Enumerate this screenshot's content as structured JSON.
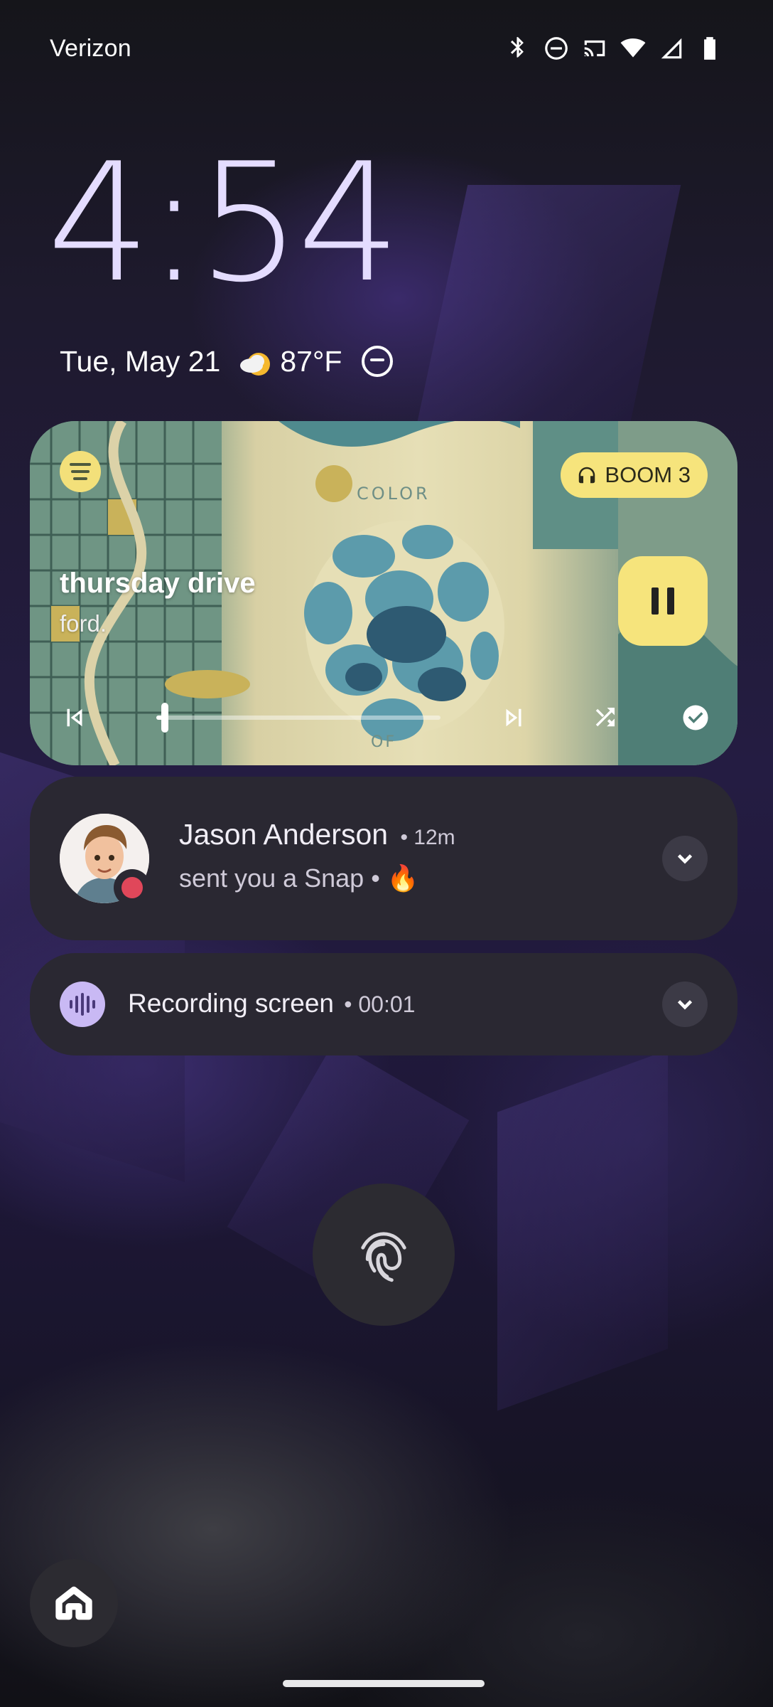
{
  "status_bar": {
    "carrier": "Verizon",
    "icons": [
      "bluetooth-icon",
      "do-not-disturb-icon",
      "cast-icon",
      "wifi-icon",
      "cell-signal-icon",
      "battery-icon"
    ]
  },
  "lockscreen": {
    "time": "4:54",
    "date": "Tue, May 21",
    "temperature": "87°F",
    "weather_icon": "partly-sunny-icon"
  },
  "media_player": {
    "app_icon": "spotify-icon",
    "output_device": "BOOM 3",
    "title": "thursday drive",
    "artist": "ford.",
    "playing": true,
    "progress": 0.03,
    "colors": {
      "accent": "#f6e47c",
      "text": "#ffffff"
    }
  },
  "notifications": [
    {
      "app": "snapchat",
      "sender": "Jason Anderson",
      "time": "• 12m",
      "message": "sent you a Snap • 🔥"
    },
    {
      "app": "screen-recorder",
      "title": "Recording screen",
      "time": "• 00:01"
    }
  ],
  "colors": {
    "clock": "#e4dcff",
    "notification_bg": "#2a2832",
    "record_icon_bg": "#c9b9f4"
  }
}
